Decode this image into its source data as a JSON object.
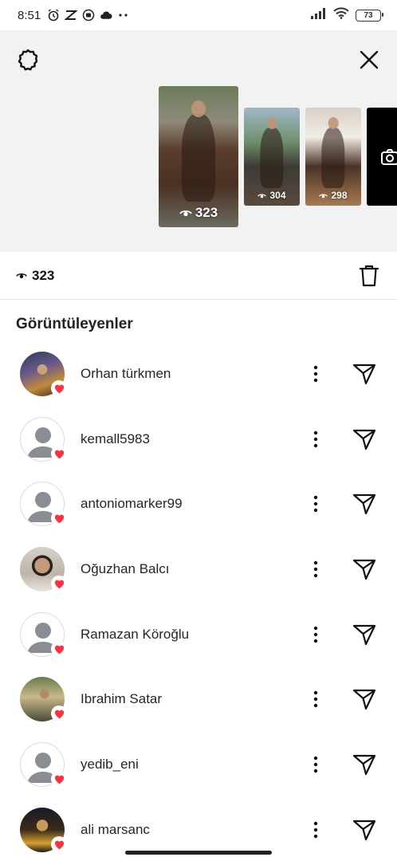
{
  "status_bar": {
    "time": "8:51",
    "battery": "73",
    "icons": [
      "alarm-icon",
      "app-icon",
      "media-icon",
      "cloud-icon",
      "more-dots-icon",
      "signal-icon",
      "wifi-icon"
    ]
  },
  "story": {
    "main_views": "323",
    "thumbnails": [
      {
        "views": "304"
      },
      {
        "views": "298"
      }
    ],
    "camera_icon": "camera-icon"
  },
  "views_row": {
    "count": "323"
  },
  "section_title": "Görüntüleyenler",
  "viewers": [
    {
      "name": "Orhan türkmen",
      "avatar": "photo",
      "liked": true
    },
    {
      "name": "kemall5983",
      "avatar": "default",
      "liked": true
    },
    {
      "name": "antoniomarker99",
      "avatar": "default",
      "liked": true
    },
    {
      "name": "Oğuzhan Balcı",
      "avatar": "photo",
      "liked": true
    },
    {
      "name": "Ramazan Köroğlu",
      "avatar": "default",
      "liked": true
    },
    {
      "name": "Ibrahim Satar",
      "avatar": "photo",
      "liked": true
    },
    {
      "name": "yedib_eni",
      "avatar": "default",
      "liked": true
    },
    {
      "name": "ali marsanc",
      "avatar": "photo",
      "liked": true
    }
  ],
  "colors": {
    "heart": "#ff3040",
    "top_background": "#f2f2f2",
    "text": "#262626"
  }
}
